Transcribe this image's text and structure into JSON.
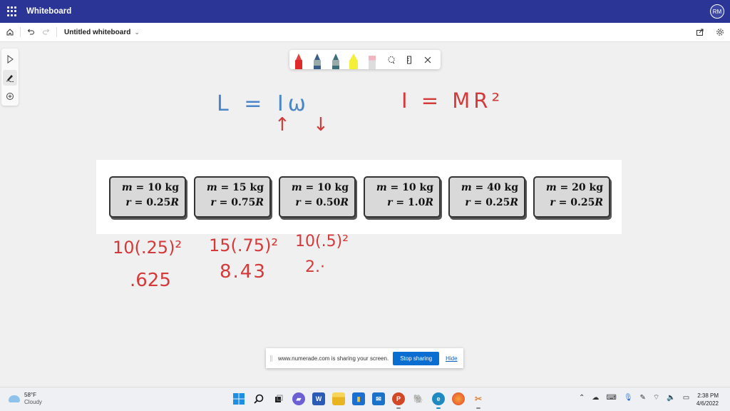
{
  "app": {
    "title": "Whiteboard",
    "user_initials": "RM"
  },
  "toolbar": {
    "doc_title": "Untitled whiteboard",
    "icons": [
      "home-icon",
      "undo-icon",
      "redo-icon"
    ],
    "right_icons": [
      "share-icon",
      "settings-icon"
    ]
  },
  "rail": {
    "tools": [
      "select-icon",
      "pen-icon",
      "add-icon"
    ],
    "active": "pen-icon"
  },
  "ink_toolbar": {
    "pens": [
      {
        "name": "red-pen",
        "color": "#e02a2a",
        "active": true
      },
      {
        "name": "blue-pen",
        "color": "#3b5d8a",
        "active": false
      },
      {
        "name": "teal-pen",
        "color": "#3d6e7a",
        "active": false
      },
      {
        "name": "highlighter",
        "color": "#f4ef3a",
        "active": false
      },
      {
        "name": "eraser",
        "color": "#f2b5bf",
        "active": false
      }
    ],
    "tools": [
      "lasso-icon",
      "ruler-icon",
      "close-icon"
    ]
  },
  "problem_cards": [
    {
      "m": "10 kg",
      "r": "0.25"
    },
    {
      "m": "15 kg",
      "r": "0.75"
    },
    {
      "m": "10 kg",
      "r": "0.50"
    },
    {
      "m": "10 kg",
      "r": "1.0"
    },
    {
      "m": "40 kg",
      "r": "0.25"
    },
    {
      "m": "20 kg",
      "r": "0.25"
    }
  ],
  "card_labels": {
    "m_var": "m",
    "r_var": "r",
    "eq": " = ",
    "R": "R"
  },
  "handwriting": {
    "eq1": "L = Iω",
    "arrows": "↑ ↓",
    "eq2": "I = MR²",
    "calc1": "10(.25)²",
    "calc2": "15(.75)²",
    "calc3": "10(.5)²",
    "res1": ".625",
    "res2": "8.43",
    "res3": "2.·"
  },
  "share_banner": {
    "message": "www.numerade.com is sharing your screen.",
    "stop_label": "Stop sharing",
    "hide_label": "Hide"
  },
  "taskbar": {
    "weather_temp": "58°F",
    "weather_desc": "Cloudy",
    "time": "2:38 PM",
    "date": "4/6/2022",
    "apps": [
      {
        "name": "start",
        "glyph": "",
        "color": "#1d8fe0"
      },
      {
        "name": "search",
        "glyph": "⚲",
        "color": "transparent"
      },
      {
        "name": "task-view",
        "glyph": "",
        "color": "#222"
      },
      {
        "name": "teams-chat",
        "glyph": "▰",
        "color": "#6b5fd3"
      },
      {
        "name": "word",
        "glyph": "W",
        "color": "#2b5bb4"
      },
      {
        "name": "file-explorer",
        "glyph": "",
        "color": "#f2c230"
      },
      {
        "name": "power-bi",
        "glyph": "",
        "color": "#1b6fd1"
      },
      {
        "name": "mail",
        "glyph": "✉",
        "color": "#1a73c9"
      },
      {
        "name": "powerpoint",
        "glyph": "P",
        "color": "#d24726"
      },
      {
        "name": "postgres",
        "glyph": "🐘",
        "color": "transparent"
      },
      {
        "name": "edge",
        "glyph": "e",
        "color": "#1e8ac2"
      },
      {
        "name": "firefox",
        "glyph": "",
        "color": "#f26a2b"
      },
      {
        "name": "snipping-tool",
        "glyph": "✂",
        "color": "transparent"
      }
    ]
  }
}
